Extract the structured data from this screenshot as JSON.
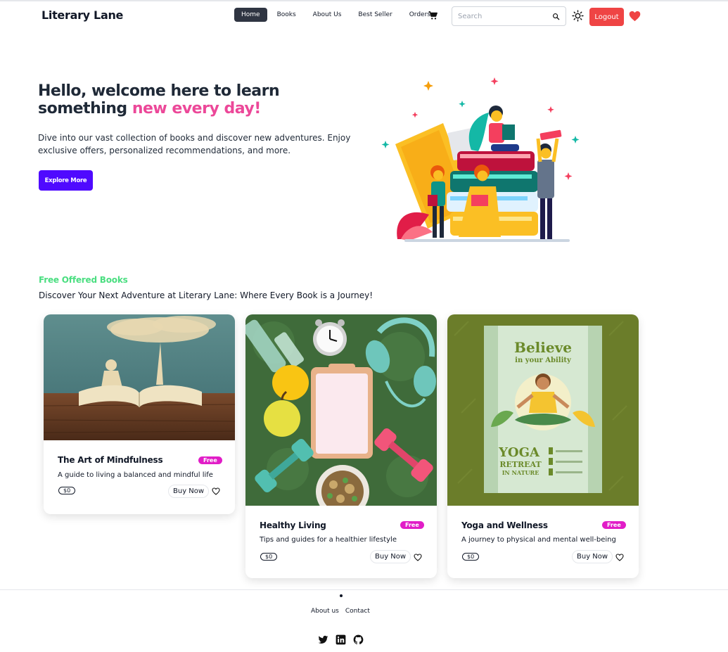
{
  "brand": "Literary Lane",
  "nav": {
    "links": [
      "Home",
      "Books",
      "About Us",
      "Best Seller",
      "Orders"
    ],
    "active": "Home",
    "search_placeholder": "Search",
    "logout_label": "Logout"
  },
  "hero": {
    "title_part1": "Hello, welcome here to learn something ",
    "title_highlight": "new every day!",
    "description": "Dive into our vast collection of books and discover new adventures. Enjoy exclusive offers, personalized recommendations, and more.",
    "cta_label": "Explore More"
  },
  "section": {
    "title": "Free Offered Books",
    "subtitle": "Discover Your Next Adventure at Literary Lane: Where Every Book is a Journey!"
  },
  "cards": [
    {
      "title": "The Art of Mindfulness",
      "badge": "Free",
      "description": "A guide to living a balanced and mindful life",
      "price": "$0",
      "buy_label": "Buy Now"
    },
    {
      "title": "Healthy Living",
      "badge": "Free",
      "description": "Tips and guides for a healthier lifestyle",
      "price": "$0",
      "buy_label": "Buy Now"
    },
    {
      "title": "Yoga and Wellness",
      "badge": "Free",
      "description": "A journey to physical and mental well-being",
      "price": "$0",
      "buy_label": "Buy Now"
    }
  ],
  "poster": {
    "headline": "Believe",
    "subheadline": "in your Ability",
    "yoga": "YOGA",
    "retreat": "RETREAT",
    "nature": "IN NATURE"
  },
  "footer": {
    "links": [
      "About us",
      "Contact"
    ]
  },
  "colors": {
    "accent_pink": "#ec4899",
    "explore_button": "#4f0aff",
    "logout_button": "#ef4444",
    "free_badge": "#e11dc7",
    "section_title": "#4ade80"
  },
  "icons": [
    "cart-icon",
    "search-icon",
    "sun-icon",
    "heart-icon",
    "twitter-icon",
    "linkedin-icon",
    "github-icon"
  ]
}
